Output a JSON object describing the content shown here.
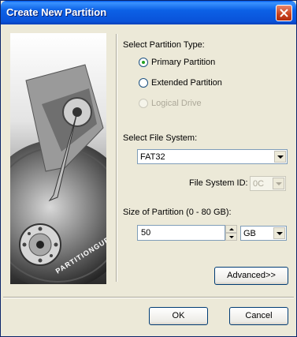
{
  "window": {
    "title": "Create New Partition"
  },
  "banner": {
    "brand_text": "PARTITIONGURU"
  },
  "partition_type": {
    "label": "Select Partition Type:",
    "options": [
      {
        "label": "Primary Partition",
        "selected": true,
        "enabled": true
      },
      {
        "label": "Extended Partition",
        "selected": false,
        "enabled": true
      },
      {
        "label": "Logical Drive",
        "selected": false,
        "enabled": false
      }
    ]
  },
  "file_system": {
    "label": "Select File System:",
    "value": "FAT32",
    "id_label": "File System ID:",
    "id_value": "0C"
  },
  "size": {
    "label": "Size of Partition (0 - 80 GB):",
    "value": "50",
    "unit": "GB"
  },
  "buttons": {
    "advanced": "Advanced>>",
    "ok": "OK",
    "cancel": "Cancel"
  },
  "colors": {
    "titlebar": "#0a52d8",
    "face": "#ece9d8",
    "radio_dot": "#21a121"
  }
}
